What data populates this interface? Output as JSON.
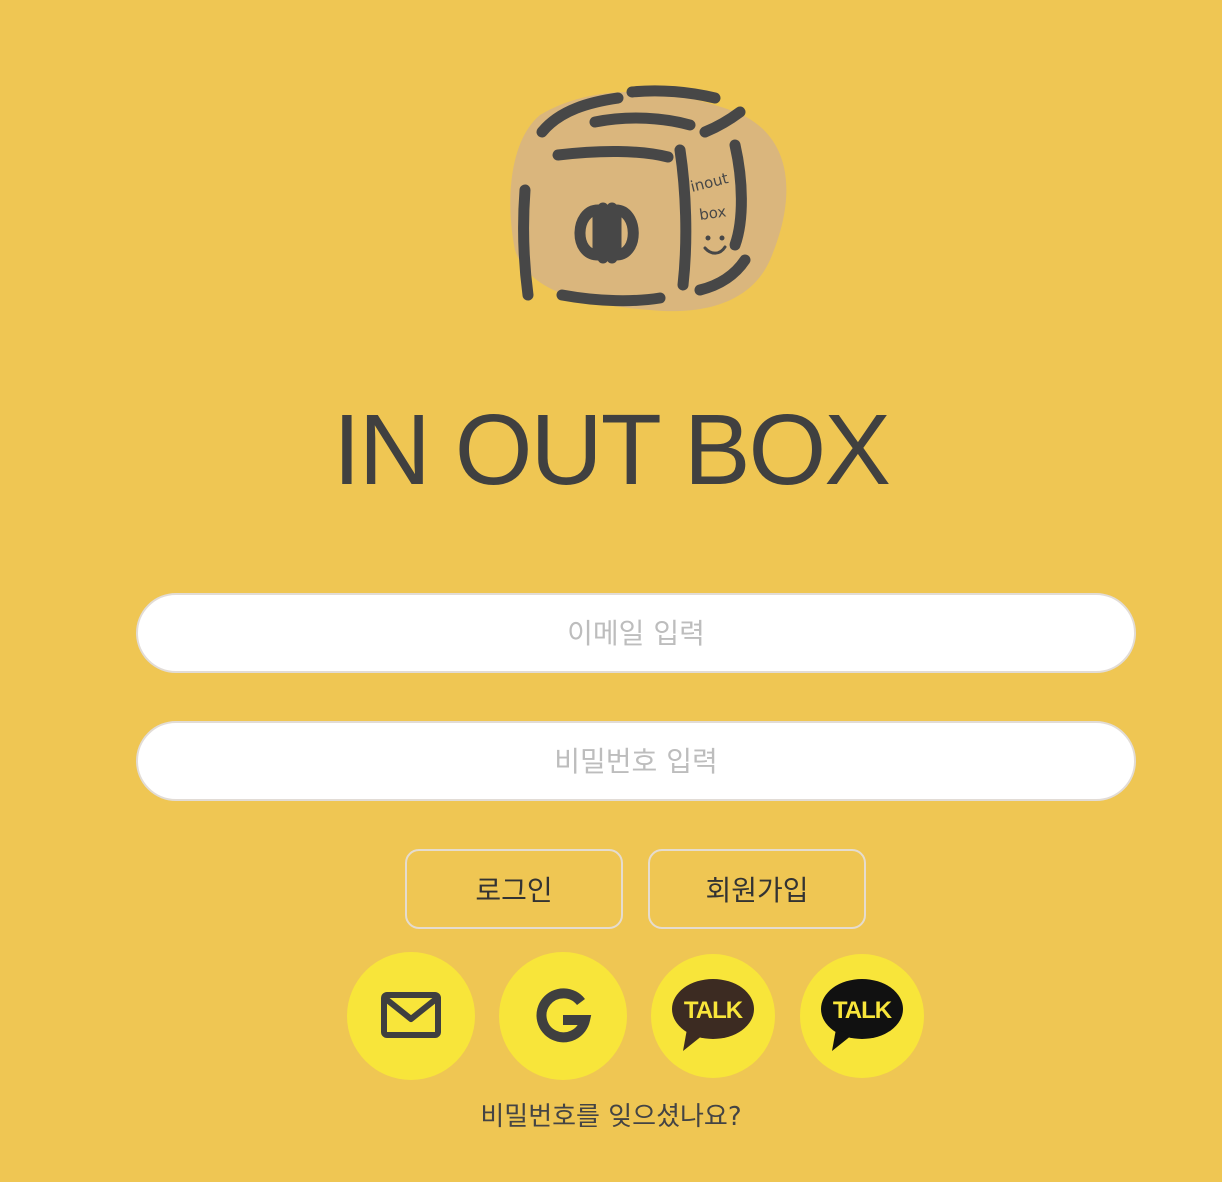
{
  "brand": {
    "logo_text_top": "inout",
    "logo_text_bottom": "box",
    "title": "IN OUT BOX"
  },
  "form": {
    "email_placeholder": "이메일 입력",
    "password_placeholder": "비밀번호 입력"
  },
  "buttons": {
    "login_label": "로그인",
    "signup_label": "회원가입"
  },
  "social": {
    "items": [
      {
        "icon": "mail-icon",
        "label": ""
      },
      {
        "icon": "google-icon",
        "label": ""
      },
      {
        "icon": "kakao-talk-icon",
        "label": "TALK"
      },
      {
        "icon": "kakao-talk-icon",
        "label": "TALK"
      }
    ]
  },
  "links": {
    "forgot_password": "비밀번호를 잊으셨나요?"
  },
  "colors": {
    "background": "#EFC653",
    "social_circle": "#F8E53A",
    "text": "#444444"
  }
}
